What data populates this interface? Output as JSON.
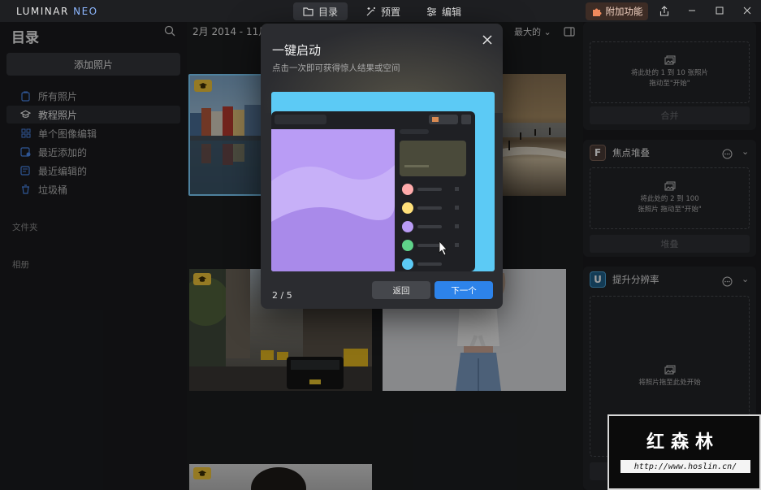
{
  "app": {
    "logo_main": "LUMINAR",
    "logo_accent": "NEO"
  },
  "toptabs": [
    {
      "label": "目录",
      "icon": "folder-icon"
    },
    {
      "label": "预置",
      "icon": "sparkle-icon"
    },
    {
      "label": "编辑",
      "icon": "sliders-icon"
    }
  ],
  "addon": {
    "label": "附加功能",
    "icon": "puzzle-icon"
  },
  "sidebar": {
    "title": "目录",
    "add_button": "添加照片",
    "items": [
      {
        "label": "所有照片",
        "icon": "photos-icon"
      },
      {
        "label": "教程照片",
        "icon": "graduation-cap-icon"
      },
      {
        "label": "单个图像编辑",
        "icon": "grid-icon"
      },
      {
        "label": "最近添加的",
        "icon": "recent-added-icon"
      },
      {
        "label": "最近编辑的",
        "icon": "recent-edited-icon"
      },
      {
        "label": "垃圾桶",
        "icon": "trash-icon"
      }
    ],
    "sections": {
      "folders": "文件夹",
      "albums": "相册"
    }
  },
  "main": {
    "date_range": "2月 2014 - 11月",
    "sort": "最大的"
  },
  "right": {
    "merge": {
      "drop_line1": "将此处的 1 到 10 张照片",
      "drop_line2": "拖动至\"开始\"",
      "button": "合并"
    },
    "focus_stack": {
      "title": "焦点堆叠",
      "icon_letter": "F",
      "drop_line1": "将此处的 2 到 100",
      "drop_line2": "张照片 拖动至\"开始\"",
      "button": "堆叠"
    },
    "upscale": {
      "title": "提升分辨率",
      "icon_letter": "U",
      "drop_line1": "将照片拖至此处开始"
    }
  },
  "modal": {
    "title": "一键启动",
    "subtitle": "点击一次即可获得惊人结果或空间",
    "page": "2 / 5",
    "back": "返回",
    "next": "下一个"
  },
  "watermark": {
    "title": "红森林",
    "url": "http://www.hoslin.cn/"
  },
  "colors": {
    "accent_blue": "#2d83ea",
    "badge_yellow": "#f0c53a",
    "illus_sky": "#5ccaf5",
    "illus_purple": "#b99cf5"
  }
}
